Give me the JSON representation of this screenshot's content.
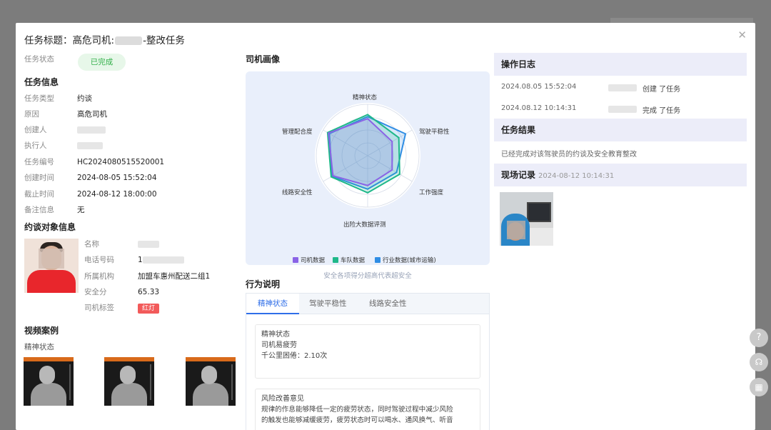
{
  "modal": {
    "title_prefix": "任务标题：高危司机:",
    "title_suffix": "-整改任务",
    "close_icon": "✕"
  },
  "task": {
    "status_label": "任务状态",
    "status_value": "已完成",
    "info_heading": "任务信息",
    "fields": [
      {
        "label": "任务类型",
        "value": "约谈"
      },
      {
        "label": "原因",
        "value": "高危司机"
      },
      {
        "label": "创建人",
        "value": ""
      },
      {
        "label": "执行人",
        "value": ""
      },
      {
        "label": "任务编号",
        "value": "HC2024080515520001"
      },
      {
        "label": "创建时间",
        "value": "2024-08-05 15:52:04"
      },
      {
        "label": "截止时间",
        "value": "2024-08-12 18:00:00"
      },
      {
        "label": "备注信息",
        "value": "无"
      }
    ]
  },
  "target": {
    "heading": "约谈对象信息",
    "fields": [
      {
        "label": "名称",
        "value": ""
      },
      {
        "label": "电话号码",
        "value": "1"
      },
      {
        "label": "所属机构",
        "value": "加盟车惠州配送二组1"
      },
      {
        "label": "安全分",
        "value": "65.33"
      },
      {
        "label": "司机标签",
        "value": "红灯"
      }
    ]
  },
  "video": {
    "heading": "视频案例",
    "subheading": "精神状态"
  },
  "portrait": {
    "heading": "司机画像",
    "axes": [
      "精神状态",
      "驾驶平稳性",
      "工作强度",
      "出险大数据评测",
      "线路安全性",
      "管理配合度"
    ],
    "footer": "安全各项得分超高代表超安全"
  },
  "chart_data": {
    "type": "radar",
    "categories": [
      "精神状态",
      "驾驶平稳性",
      "工作强度",
      "出险大数据评测",
      "线路安全性",
      "管理配合度"
    ],
    "range": [
      0,
      100
    ],
    "series": [
      {
        "name": "司机数据",
        "color": "#8a63e6",
        "values": [
          72,
          55,
          55,
          58,
          78,
          88
        ]
      },
      {
        "name": "车队数据",
        "color": "#1fb88a",
        "values": [
          80,
          70,
          72,
          72,
          82,
          90
        ]
      },
      {
        "name": "行业数据(城市运输)",
        "color": "#2f8de4",
        "values": [
          76,
          85,
          65,
          65,
          80,
          86
        ]
      }
    ]
  },
  "behavior": {
    "heading": "行为说明",
    "tabs": [
      "精神状态",
      "驾驶平稳性",
      "线路安全性"
    ],
    "box1": {
      "title": "精神状态",
      "line1": "司机易疲劳",
      "line2": "千公里困倦：2.10次"
    },
    "box2": {
      "title": "风险改善意见",
      "line1": "规律的作息能够降低一定的疲劳状态，同时驾驶过程中减少风险",
      "line2": "的触发也能够减缓疲劳，疲劳状态时可以喝水、通风换气、听音"
    }
  },
  "log": {
    "heading": "操作日志",
    "entries": [
      {
        "time": "2024.08.05 15:52:04",
        "action": "创建 了任务"
      },
      {
        "time": "2024.08.12 10:14:31",
        "action": "完成 了任务"
      }
    ]
  },
  "result": {
    "heading": "任务结果",
    "text": "已经完成对该驾驶员的约谈及安全教育整改"
  },
  "scene": {
    "heading": "现场记录",
    "time": "2024-08-12 10:14:31"
  },
  "floating": {
    "help": "?",
    "headset": "☊",
    "grid": "▦"
  }
}
